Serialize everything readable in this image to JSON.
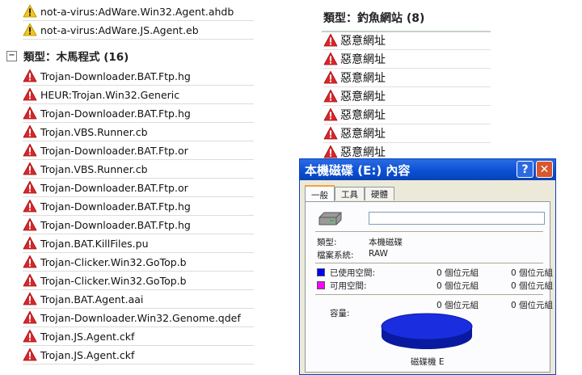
{
  "left_list": {
    "items": [
      {
        "name": "not-a-virus:AdWare.Win32.Agent.ahdb",
        "severity": "warning"
      },
      {
        "name": "not-a-virus:AdWare.JS.Agent.eb",
        "severity": "warning"
      }
    ],
    "category": {
      "expander": "−",
      "title": "類型：木馬程式 (16)"
    },
    "trojans": [
      "Trojan-Downloader.BAT.Ftp.hg",
      "HEUR:Trojan.Win32.Generic",
      "Trojan-Downloader.BAT.Ftp.hg",
      "Trojan.VBS.Runner.cb",
      "Trojan-Downloader.BAT.Ftp.or",
      "Trojan.VBS.Runner.cb",
      "Trojan-Downloader.BAT.Ftp.or",
      "Trojan-Downloader.BAT.Ftp.hg",
      "Trojan-Downloader.BAT.Ftp.hg",
      "Trojan.BAT.KillFiles.pu",
      "Trojan-Clicker.Win32.GoTop.b",
      "Trojan-Clicker.Win32.GoTop.b",
      "Trojan.BAT.Agent.aai",
      "Trojan-Downloader.Win32.Genome.qdef",
      "Trojan.JS.Agent.ckf",
      "Trojan.JS.Agent.ckf"
    ]
  },
  "right_list": {
    "title": "類型：釣魚網站 (8)",
    "items": [
      "惡意網址",
      "惡意網址",
      "惡意網址",
      "惡意網址",
      "惡意網址",
      "惡意網址",
      "惡意網址"
    ]
  },
  "dialog": {
    "title": "本機磁碟 (E:) 內容",
    "help_label": "?",
    "close_label": "✕",
    "tabs": [
      "一般",
      "工具",
      "硬體"
    ],
    "type_label": "類型:",
    "type_value": "本機磁碟",
    "fs_label": "檔案系統:",
    "fs_value": "RAW",
    "used_label": "已使用空間:",
    "used_bytes": "0 個位元組",
    "used_size": "0 個位元組",
    "free_label": "可用空間:",
    "free_bytes": "0 個位元組",
    "free_size": "0 個位元組",
    "capacity_label": "容量:",
    "cap_bytes": "0 個位元組",
    "cap_size": "0 個位元組",
    "drive_label": "磁碟機 E",
    "colors": {
      "used": "#0000ff",
      "free": "#ff00ff",
      "pie": "#1a2ee0"
    }
  }
}
